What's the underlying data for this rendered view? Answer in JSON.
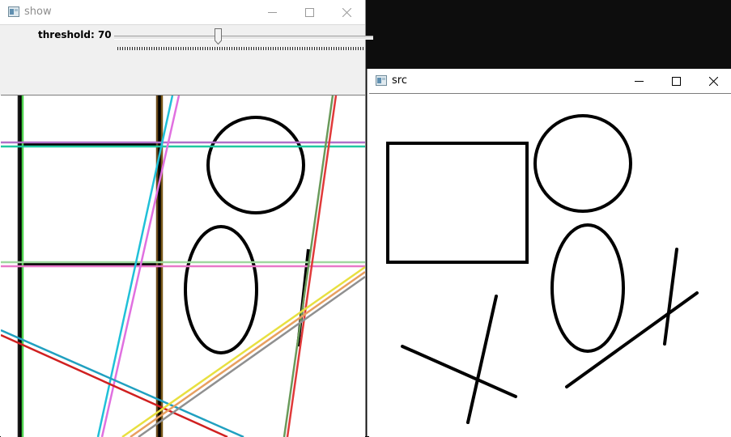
{
  "windows": {
    "show": {
      "title": "show"
    },
    "src": {
      "title": "src"
    }
  },
  "trackbar": {
    "label": "threshold: 70",
    "value": 70
  },
  "icons": {
    "app": "window-app-icon",
    "minimize": "minimize-icon",
    "maximize": "maximize-icon",
    "close": "close-icon"
  },
  "colors": {
    "desktop": "#0d0d0d",
    "toolbar": "#f0f0f0",
    "shape_stroke": "#000000"
  }
}
